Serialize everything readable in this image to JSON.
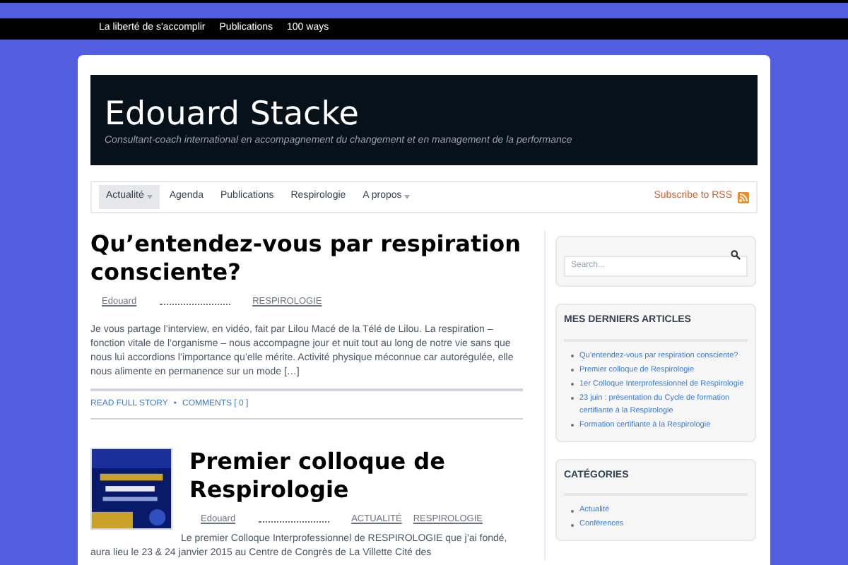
{
  "top_menu": [
    "La liberté de s'accomplir",
    "Publications",
    "100 ways"
  ],
  "header": {
    "title": "Edouard Stacke",
    "tagline": "Consultant-coach international en accompagnement du changement et en management de la performance"
  },
  "nav": {
    "items": [
      {
        "label": "Actualité",
        "selected": true,
        "has_submenu": true
      },
      {
        "label": "Agenda",
        "selected": false,
        "has_submenu": false
      },
      {
        "label": "Publications",
        "selected": false,
        "has_submenu": false
      },
      {
        "label": "Respirologie",
        "selected": false,
        "has_submenu": false
      },
      {
        "label": "A propos",
        "selected": false,
        "has_submenu": true
      }
    ],
    "rss": "Subscribe to RSS"
  },
  "posts": [
    {
      "title": "Qu’entendez-vous par respiration consciente?",
      "author": "Edouard",
      "categories": [
        "RESPIROLOGIE"
      ],
      "has_thumbnail": false,
      "excerpt": "Je vous partage l’interview, en vidéo, fait par Lilou Macé de la Télé de Lilou. La respiration – fonction vitale de l’organisme – nous accompagne jour et nuit tout au long de notre vie sans que nous lui accordions l’importance qu’elle mérite. Activité physique méconnue car autorégulée, elle nous alimente en permanence sur un mode […]",
      "footer_link": "READ FULL STORY",
      "footer_separator": "•",
      "comments": "COMMENTS [ 0 ]"
    },
    {
      "title": "Premier colloque de Respirologie",
      "author": "Edouard",
      "categories": [
        "ACTUALITÉ",
        "RESPIROLOGIE"
      ],
      "has_thumbnail": true,
      "excerpt": "Le premier Colloque Interprofessionnel de RESPIROLOGIE que j’ai fondé, aura lieu le 23 & 24 janvier 2015 au Centre de Congrès de La Villette Cité des"
    }
  ],
  "sidebar": {
    "search": {
      "placeholder": "Search..."
    },
    "widgets": [
      {
        "title": "MES DERNIERS ARTICLES",
        "items": [
          "Qu’entendez-vous par respiration consciente?",
          "Premier colloque de Respirologie",
          "1er Colloque Interprofessionnel de Respirologie",
          "23 juin : présentation du Cycle de formation certifiante à la Respirologie",
          "Formation certifiante à la Respirologie"
        ]
      },
      {
        "title": "CATÉGORIES",
        "items": [
          "Actualité",
          "Conférences"
        ]
      }
    ]
  }
}
